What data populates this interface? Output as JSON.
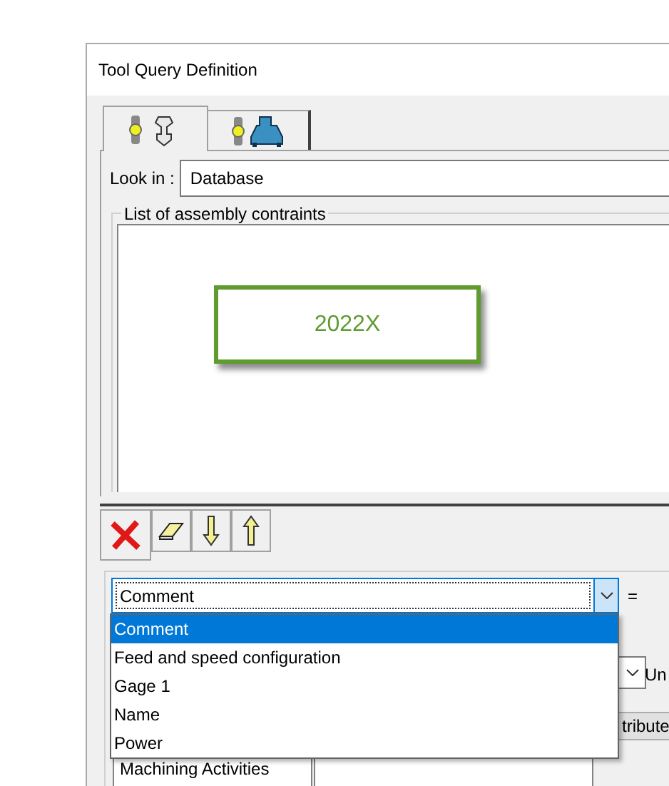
{
  "window": {
    "title": "Tool Query Definition"
  },
  "tabs": [
    {
      "kind": "tool",
      "selected": true
    },
    {
      "kind": "machine",
      "selected": false
    }
  ],
  "look_in": {
    "label": "Look in :",
    "value": "Database"
  },
  "constraints": {
    "title": "List of assembly contraints",
    "badge": "2022X"
  },
  "attribute_combo": {
    "value": "Comment",
    "expanded": true,
    "options": [
      {
        "label": "Comment",
        "selected": true
      },
      {
        "label": "Feed and speed configuration",
        "selected": false
      },
      {
        "label": "Gage 1",
        "selected": false
      },
      {
        "label": "Name",
        "selected": false
      },
      {
        "label": "Power",
        "selected": false
      }
    ]
  },
  "operator_combo": {
    "value": "="
  },
  "unit_label": "Un",
  "attribute_button": "tribute",
  "feature_list": [
    "Machining Activities"
  ]
}
